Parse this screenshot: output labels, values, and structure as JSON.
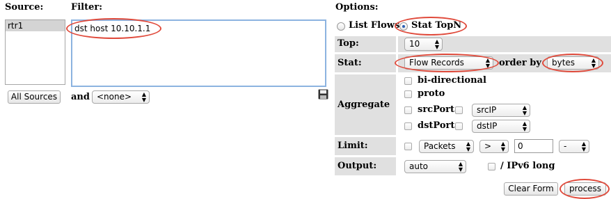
{
  "source": {
    "heading": "Source:",
    "items": [
      "rtr1"
    ],
    "all_sources_label": "All Sources"
  },
  "filter": {
    "heading": "Filter:",
    "value": "dst host 10.10.1.1",
    "and_label": "and",
    "and_select": "<none>"
  },
  "options": {
    "heading": "Options:",
    "list_flows_label": "List Flows",
    "stat_topn_label": "Stat TopN",
    "selected_mode": "Stat TopN",
    "top": {
      "label": "Top:",
      "value": "10"
    },
    "stat": {
      "label": "Stat:",
      "value": "Flow Records",
      "order_by_label": "order by",
      "order_by_value": "bytes"
    },
    "aggregate": {
      "label": "Aggregate",
      "bidirectional": "bi-directional",
      "proto": "proto",
      "srcport": "srcPort",
      "srcport_select": "srcIP",
      "dstport": "dstPort",
      "dstport_select": "dstIP"
    },
    "limit": {
      "label": "Limit:",
      "type": "Packets",
      "op": ">",
      "value": "0",
      "unit": "-"
    },
    "output": {
      "label": "Output:",
      "format": "auto",
      "ipv6_label": "/ IPv6 long"
    },
    "clear_form_label": "Clear Form",
    "process_label": "process"
  },
  "icons": [
    "save-icon",
    "radio-icon",
    "checkbox-icon",
    "chevron-updown-icon"
  ],
  "colors": {
    "highlight_ring": "#e04a3b",
    "label_cell_bg": "#e0e0e0",
    "textarea_focus": "#8cb3e0"
  }
}
